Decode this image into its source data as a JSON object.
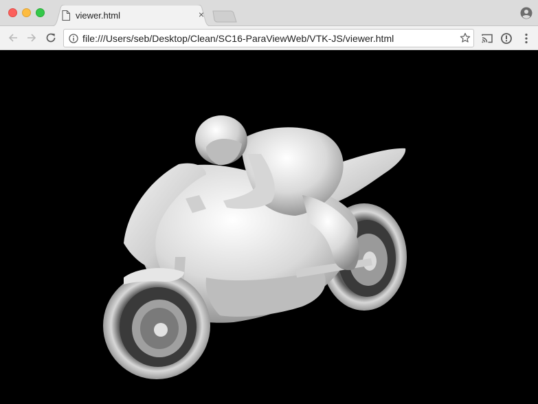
{
  "browser": {
    "tab": {
      "title": "viewer.html",
      "close_glyph": "×",
      "icon": "file-icon"
    },
    "address_bar": {
      "url": "file:///Users/seb/Desktop/Clean/SC16-ParaViewWeb/VTK-JS/viewer.html"
    },
    "icons": [
      "back-arrow-icon",
      "forward-arrow-icon",
      "reload-icon",
      "info-icon",
      "star-icon",
      "cast-icon",
      "extension-info-icon",
      "kebab-menu-icon",
      "profile-icon"
    ]
  },
  "viewer": {
    "background": "#000000",
    "model_color": "#d8d8d8",
    "scene": "motorbike-with-rider-3d-render"
  },
  "colors": {
    "close": "#fc605c",
    "minimize": "#fdbc40",
    "maximize": "#34c84a"
  }
}
